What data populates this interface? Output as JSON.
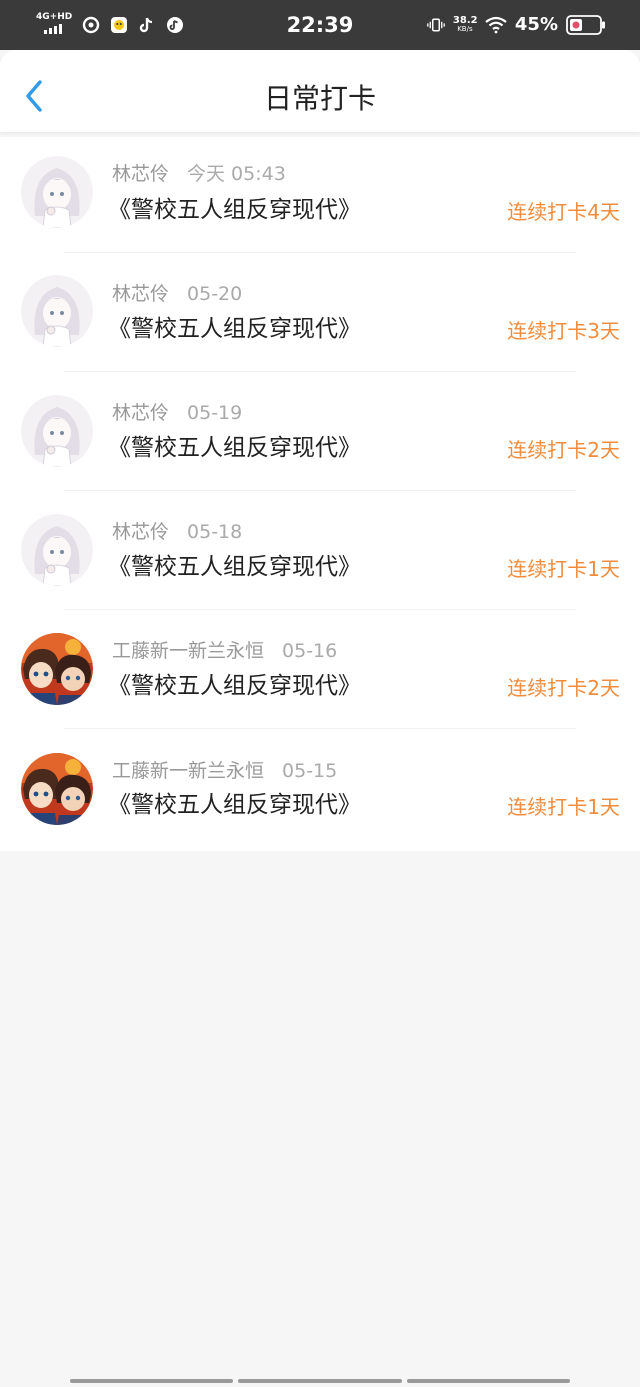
{
  "status_bar": {
    "network": "4G+HD",
    "time": "22:39",
    "speed_value": "38.2",
    "speed_unit": "KB/s",
    "battery": "45%",
    "icons": [
      "signal-icon",
      "app-icon",
      "qq-icon",
      "tiktok-icon",
      "music-icon",
      "vibrate-icon",
      "wifi-icon",
      "battery-icon"
    ]
  },
  "header": {
    "title": "日常打卡",
    "back_icon": "back-chevron-icon"
  },
  "colors": {
    "accent": "#f08c3c",
    "back": "#2f9be8",
    "text": "#222222",
    "muted": "#999999"
  },
  "records": [
    {
      "user": "林芯伶",
      "date": "今天 05:43",
      "book": "《警校五人组反穿现代》",
      "streak": "连续打卡4天",
      "avatar": "anime-girl-avatar"
    },
    {
      "user": "林芯伶",
      "date": "05-20",
      "book": "《警校五人组反穿现代》",
      "streak": "连续打卡3天",
      "avatar": "anime-girl-avatar"
    },
    {
      "user": "林芯伶",
      "date": "05-19",
      "book": "《警校五人组反穿现代》",
      "streak": "连续打卡2天",
      "avatar": "anime-girl-avatar"
    },
    {
      "user": "林芯伶",
      "date": "05-18",
      "book": "《警校五人组反穿现代》",
      "streak": "连续打卡1天",
      "avatar": "anime-girl-avatar"
    },
    {
      "user": "工藤新一新兰永恒",
      "date": "05-16",
      "book": "《警校五人组反穿现代》",
      "streak": "连续打卡2天",
      "avatar": "anime-boys-avatar"
    },
    {
      "user": "工藤新一新兰永恒",
      "date": "05-15",
      "book": "《警校五人组反穿现代》",
      "streak": "连续打卡1天",
      "avatar": "anime-boys-avatar"
    }
  ]
}
